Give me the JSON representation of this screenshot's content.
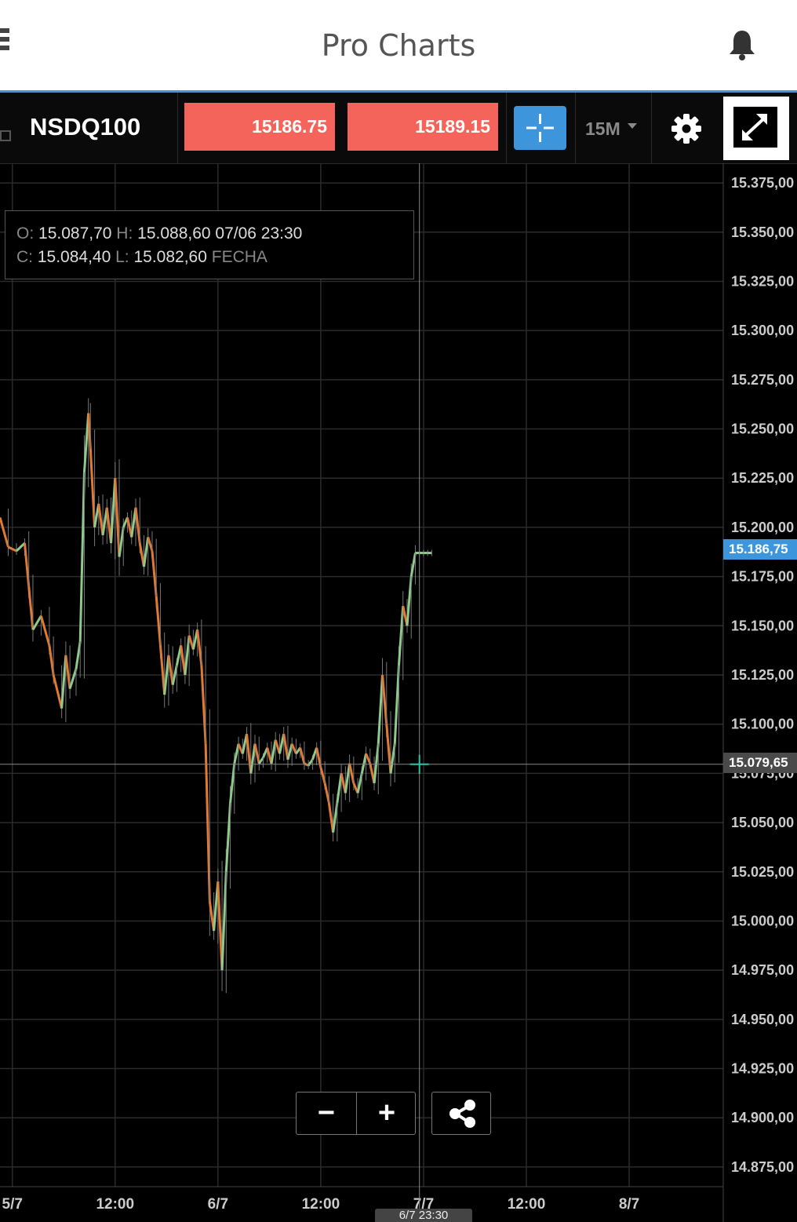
{
  "app": {
    "title": "Pro Charts"
  },
  "toolbar": {
    "symbol": "NSDQ100",
    "sell_price": "15186.75",
    "buy_price": "15189.15",
    "timeframe": "15M",
    "price_color": "#f4645a",
    "accent_color": "#3d96dc"
  },
  "ohlc": {
    "o_label": "O:",
    "o_value": "15.087,70",
    "h_label": "H:",
    "h_value": "15.088,60",
    "c_label": "C:",
    "c_value": "15.084,40",
    "l_label": "L:",
    "l_value": "15.082,60",
    "datetime": "07/06 23:30",
    "date_label": "FECHA"
  },
  "controls": {
    "zoom_out": "−",
    "zoom_in": "+"
  },
  "tags": {
    "current_price": "15.186,75",
    "cursor_price": "15.079,65",
    "cursor_time": "6/7 23:30"
  },
  "chart_data": {
    "type": "line",
    "ylim": [
      14865,
      15385
    ],
    "y_ticks": [
      "15.375,00",
      "15.350,00",
      "15.325,00",
      "15.300,00",
      "15.275,00",
      "15.250,00",
      "15.225,00",
      "15.200,00",
      "15.175,00",
      "15.150,00",
      "15.125,00",
      "15.100,00",
      "15.075,00",
      "15.050,00",
      "15.025,00",
      "15.000,00",
      "14.975,00",
      "14.950,00",
      "14.925,00",
      "14.900,00",
      "14.875,00"
    ],
    "y_tick_values": [
      15375,
      15350,
      15325,
      15300,
      15275,
      15250,
      15225,
      15200,
      15175,
      15150,
      15125,
      15100,
      15075,
      15050,
      15025,
      15000,
      14975,
      14950,
      14925,
      14900,
      14875
    ],
    "x_ticks": [
      "5/7",
      "12:00",
      "6/7",
      "12:00",
      "7/7",
      "12:00",
      "8/7"
    ],
    "x_tick_values": [
      5.0,
      5.5,
      6.0,
      6.5,
      7.0,
      7.5,
      8.0
    ],
    "xlim": [
      4.94,
      8.45
    ],
    "grid": true,
    "bull_color": "#8fc98b",
    "bear_color": "#e07a35",
    "cursor": {
      "x": 6.98,
      "y": 15079.65
    },
    "series": [
      {
        "x": [
          4.94,
          4.98,
          5.02,
          5.06,
          5.08,
          5.1,
          5.14,
          5.18,
          5.2,
          5.24,
          5.26,
          5.28,
          5.31,
          5.33,
          5.35,
          5.37,
          5.38,
          5.4,
          5.42,
          5.44,
          5.46,
          5.48,
          5.5,
          5.52,
          5.54,
          5.56,
          5.58,
          5.6,
          5.62,
          5.64,
          5.66,
          5.68,
          5.7,
          5.72,
          5.74,
          5.76,
          5.78,
          5.8,
          5.82,
          5.84,
          5.86,
          5.88,
          5.9,
          5.92,
          5.94,
          5.96,
          5.98,
          6.0,
          6.02,
          6.04,
          6.06,
          6.08,
          6.1,
          6.12,
          6.14,
          6.16,
          6.18,
          6.2,
          6.22,
          6.24,
          6.26,
          6.28,
          6.3,
          6.32,
          6.34,
          6.36,
          6.38,
          6.4,
          6.42,
          6.44,
          6.46,
          6.48,
          6.5,
          6.52,
          6.54,
          6.56,
          6.58,
          6.6,
          6.62,
          6.64,
          6.66,
          6.68,
          6.7,
          6.72,
          6.74,
          6.76,
          6.78,
          6.8,
          6.82,
          6.84,
          6.86,
          6.88,
          6.9,
          6.92,
          6.94,
          6.96,
          6.98,
          7.0,
          7.02,
          7.04,
          7.06,
          7.08,
          7.1,
          7.12,
          7.14,
          7.16,
          7.18,
          7.2,
          7.22,
          7.24,
          7.26,
          7.28,
          7.3,
          7.32,
          7.34,
          7.36,
          7.38,
          7.4,
          7.42,
          7.44,
          7.46,
          7.48,
          7.5,
          7.52,
          7.54
        ],
        "y": [
          15205,
          15190,
          15188,
          15192,
          15170,
          15148,
          15155,
          15140,
          15125,
          15108,
          15135,
          15118,
          15128,
          15142,
          15228,
          15258,
          15240,
          15200,
          15212,
          15196,
          15210,
          15192,
          15225,
          15185,
          15200,
          15205,
          15195,
          15210,
          15192,
          15180,
          15195,
          15188,
          15165,
          15140,
          15115,
          15135,
          15120,
          15130,
          15140,
          15125,
          15145,
          15138,
          15148,
          15130,
          15090,
          15010,
          14995,
          15020,
          14975,
          15025,
          15060,
          15080,
          15090,
          15085,
          15095,
          15075,
          15090,
          15080,
          15083,
          15088,
          15080,
          15092,
          15085,
          15095,
          15082,
          15090,
          15085,
          15088,
          15080,
          15079,
          15082,
          15088,
          15078,
          15070,
          15060,
          15045,
          15060,
          15075,
          15065,
          15080,
          15070,
          15065,
          15075,
          15085,
          15080,
          15070,
          15090,
          15125,
          15100,
          15075,
          15090,
          15130,
          15160,
          15150,
          15175,
          15187,
          15187,
          15187,
          15187,
          15187,
          15187,
          15187,
          15187,
          15187,
          15187,
          15187,
          15187,
          15187,
          15187,
          15187,
          15187,
          15187,
          15187,
          15187,
          15187,
          15187,
          15187,
          15187,
          15187,
          15187,
          15187,
          15187,
          15187,
          15187,
          15187
        ]
      }
    ]
  }
}
